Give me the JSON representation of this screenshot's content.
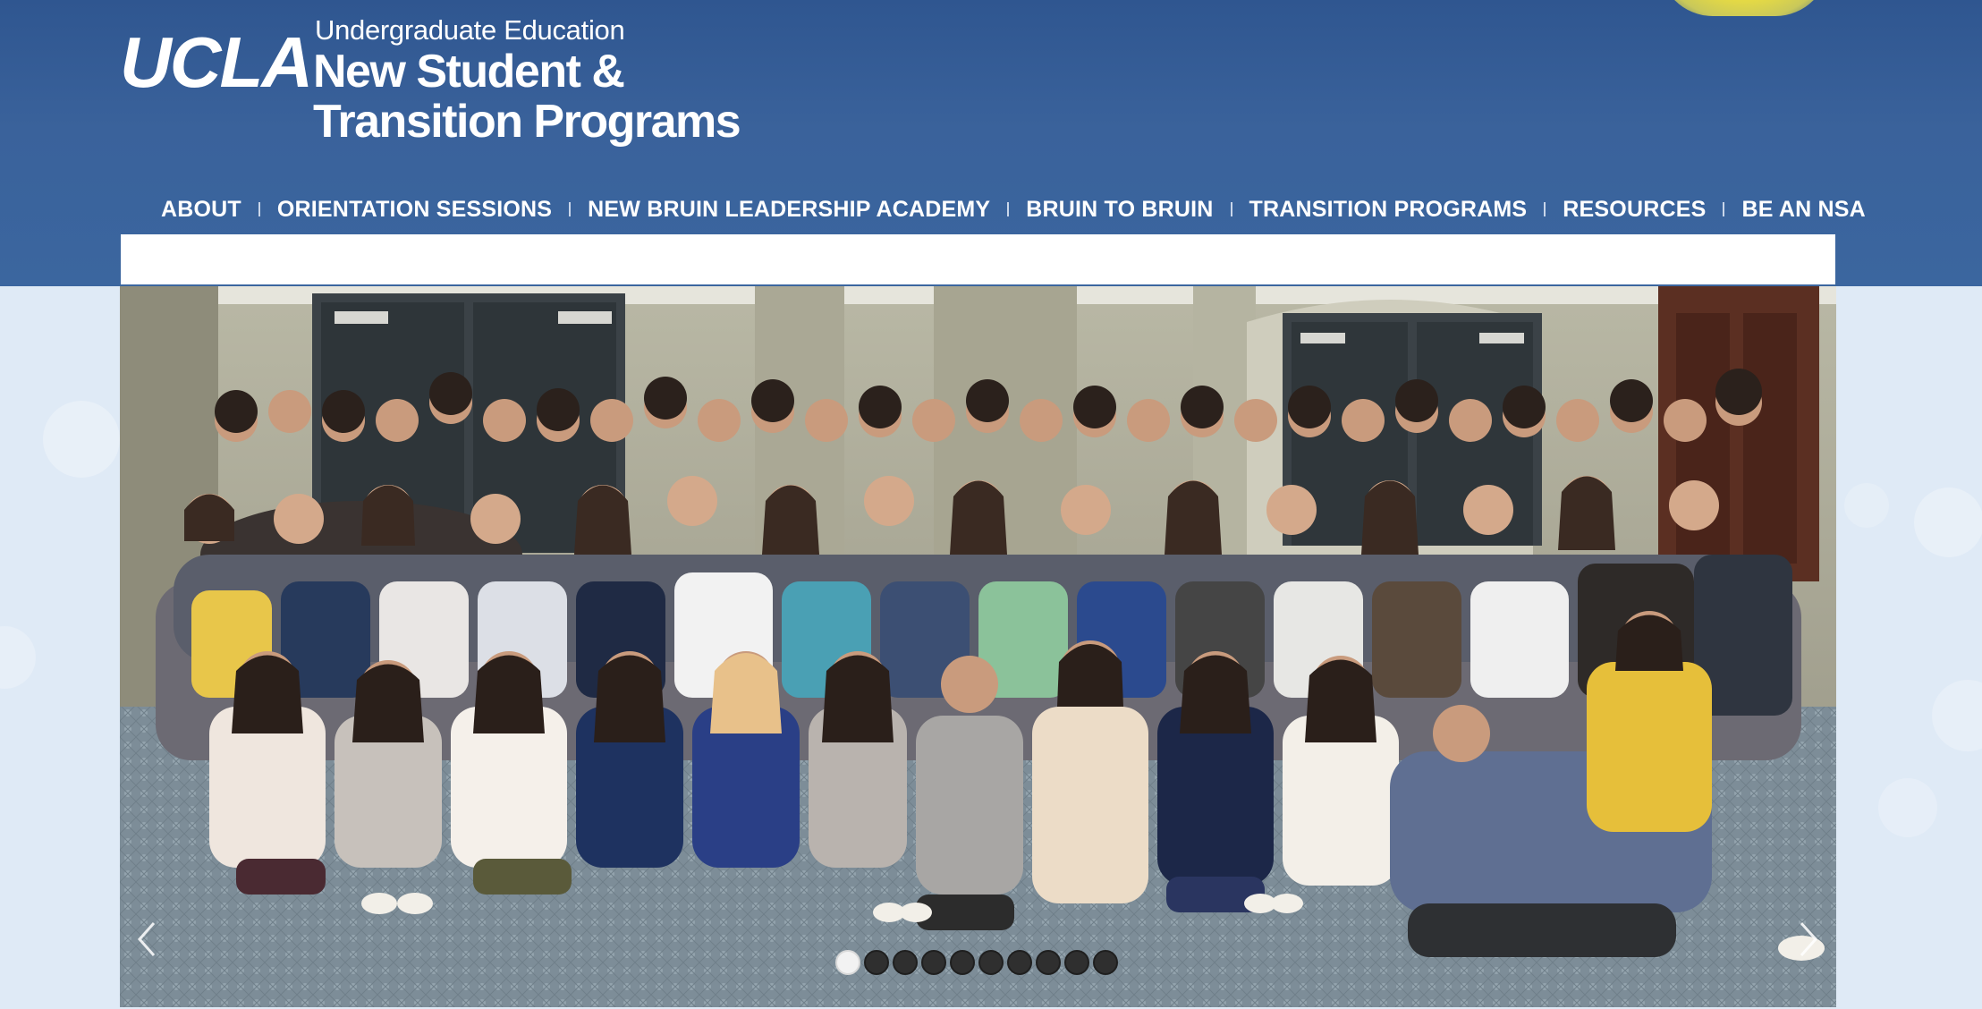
{
  "logo": {
    "wordmark": "UCLA",
    "subtitle": "Undergraduate Education",
    "title_line1": "New Student &",
    "title_line2": "Transition Programs"
  },
  "nav": {
    "items": [
      {
        "label": "ABOUT"
      },
      {
        "label": "ORIENTATION SESSIONS"
      },
      {
        "label": "NEW BRUIN LEADERSHIP ACADEMY"
      },
      {
        "label": "BRUIN TO BRUIN"
      },
      {
        "label": "TRANSITION PROGRAMS"
      },
      {
        "label": "RESOURCES"
      },
      {
        "label": "BE AN NSA"
      }
    ]
  },
  "slideshow": {
    "slide_count": 10,
    "active_index": 0,
    "photo_subject": "group-photo"
  },
  "colors": {
    "header": "#3a629b",
    "nav_text": "#ffffff",
    "accent_yellow": "#f2e23a",
    "page_background": "#dfeaf6"
  },
  "icons": {
    "prev": "chevron-left-icon",
    "next": "chevron-right-icon"
  }
}
